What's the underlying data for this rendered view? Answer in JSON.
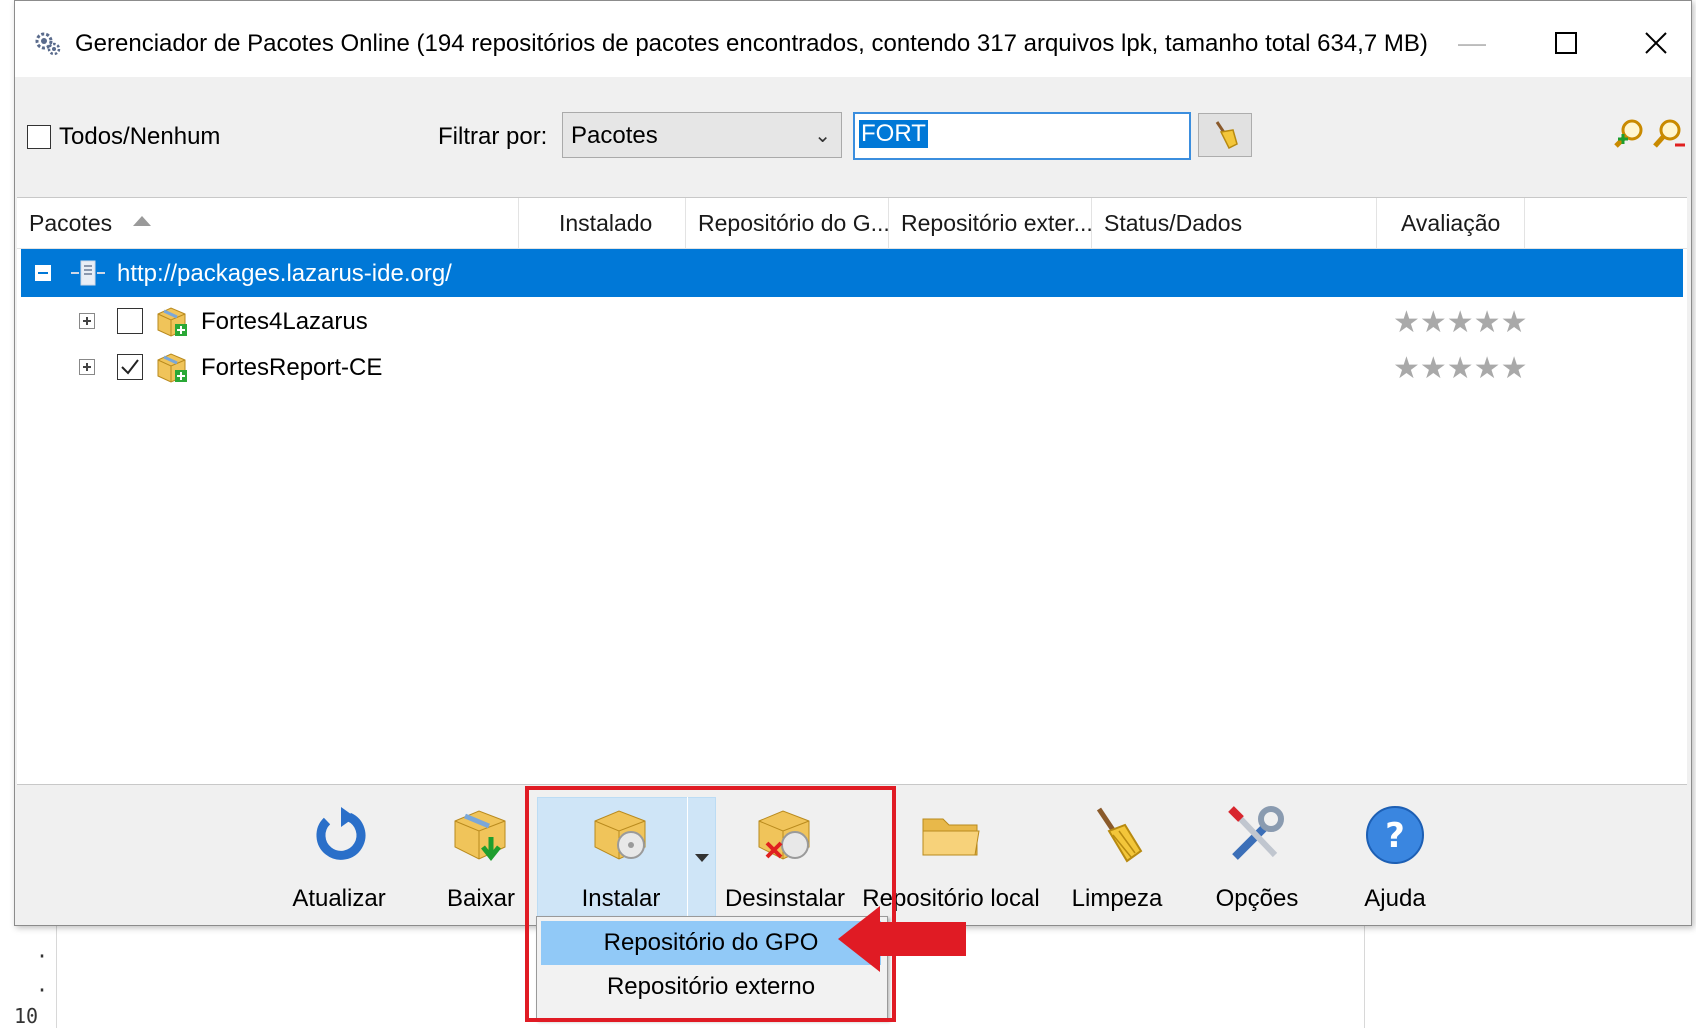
{
  "window": {
    "title": "Gerenciador de Pacotes Online (194 repositórios de pacotes encontrados, contendo 317 arquivos lpk, tamanho total 634,7 MB)",
    "minimize_icon": "minimize-icon",
    "maximize_icon": "maximize-icon",
    "close_icon": "close-icon"
  },
  "filter_bar": {
    "select_all_label": "Todos/Nenhum",
    "select_all_checked": false,
    "filter_by_label": "Filtrar por:",
    "filter_by_value": "Pacotes",
    "search_value": "FORT"
  },
  "table": {
    "columns": [
      "Pacotes",
      "Instalado",
      "Repositório do G...",
      "Repositório exter...",
      "Status/Dados",
      "Avaliação"
    ],
    "repository": "http://packages.lazarus-ide.org/",
    "rows": [
      {
        "name": "Fortes4Lazarus",
        "checked": false,
        "rating": 0,
        "rating_stars": "★★★★★"
      },
      {
        "name": "FortesReport-CE",
        "checked": true,
        "rating": 0,
        "rating_stars": "★★★★★"
      }
    ]
  },
  "toolbar": {
    "atualizar": "Atualizar",
    "baixar": "Baixar",
    "instalar": "Instalar",
    "desinstalar": "Desinstalar",
    "repositorio_local": "Repositório local",
    "limpeza": "Limpeza",
    "opcoes": "Opções",
    "ajuda": "Ajuda"
  },
  "install_menu": {
    "items": [
      "Repositório do GPO",
      "Repositório externo"
    ],
    "highlighted": "Repositório do GPO"
  },
  "background": {
    "line_number": "10"
  },
  "colors": {
    "selection": "#0078d7",
    "annotation": "#e01b24",
    "menu_highlight": "#91c9f7"
  }
}
